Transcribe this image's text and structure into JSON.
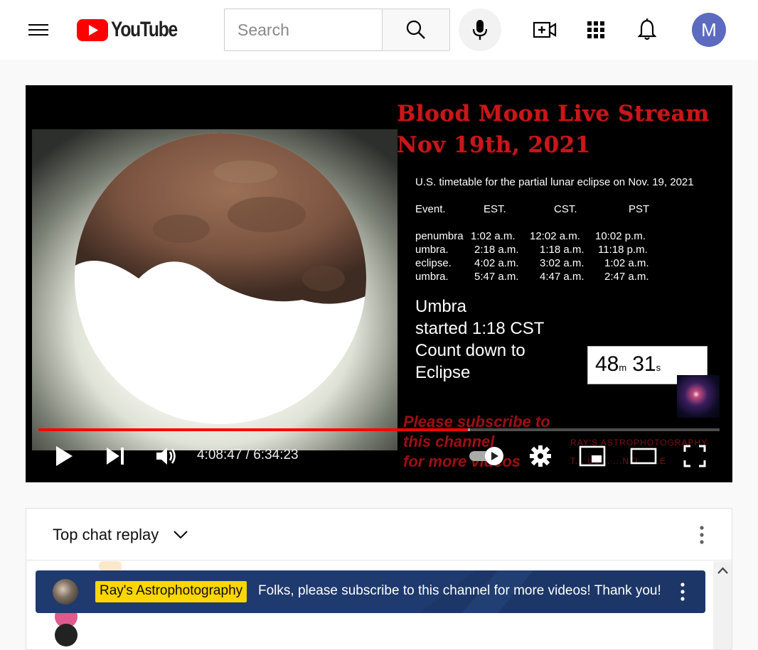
{
  "header": {
    "logo_text": "YouTube",
    "search_placeholder": "Search",
    "avatar_letter": "M",
    "icons": [
      "menu-icon",
      "youtube-logo-icon",
      "search-icon",
      "mic-icon",
      "create-video-icon",
      "apps-grid-icon",
      "notifications-bell-icon"
    ]
  },
  "video": {
    "title_line1": "Blood Moon Live Stream",
    "title_line2": "Nov 19th, 2021",
    "table_title": "U.S. timetable for the partial lunar eclipse on Nov. 19, 2021",
    "table_headers": [
      "Event.",
      "EST.",
      "CST.",
      "PST"
    ],
    "table_rows": [
      [
        "penumbra",
        "1:02 a.m.",
        "12:02 a.m.",
        "10:02 p.m."
      ],
      [
        "umbra.",
        "2:18 a.m.",
        "1:18 a.m.",
        "11:18 p.m."
      ],
      [
        "eclipse.",
        "4:02 a.m.",
        "3:02 a.m.",
        "1:02 a.m."
      ],
      [
        "umbra.",
        "5:47 a.m.",
        "4:47 a.m.",
        "2:47 a.m."
      ]
    ],
    "umbra_lines": [
      "Umbra",
      "started 1:18 CST",
      "Count down to",
      "Eclipse"
    ],
    "countdown_minutes": "48",
    "countdown_minutes_unit": "m",
    "countdown_seconds": "31",
    "countdown_seconds_unit": "s",
    "watermark_subscribe": [
      "Please subscribe to",
      "this channel",
      "for more videos"
    ],
    "watermark_rays": [
      "RAY'S ASTROPHOTOGRAPHY",
      "T... US... ...NTI... ...E"
    ],
    "time_display": "4:08:47 / 6:34:23",
    "progress_played_fraction": 0.63,
    "progress_loaded_fraction": 0.634,
    "autoplay_on": true,
    "colors": {
      "progress": "#ff0000",
      "title_red": "#c8171a",
      "chip": "#ffd600"
    }
  },
  "chat": {
    "title": "Top chat replay",
    "pinned": {
      "author": "Ray's Astrophotography",
      "message": "Folks, please subscribe to this channel for more videos! Thank you!"
    }
  }
}
